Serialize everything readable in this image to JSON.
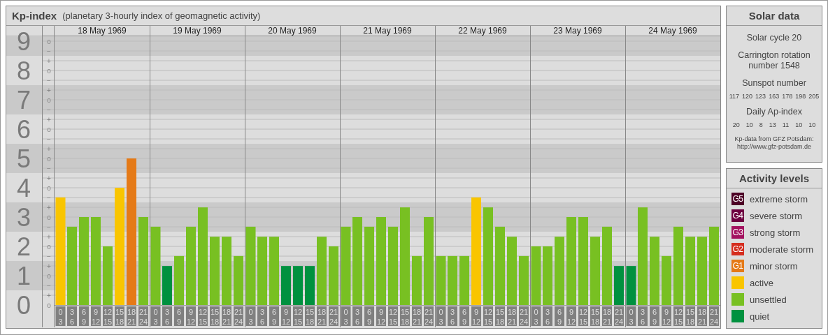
{
  "title": {
    "name": "Kp-index",
    "subtitle": "(planetary 3-hourly index of geomagnetic activity)"
  },
  "chart": {
    "dates": [
      "18 May 1969",
      "19 May 1969",
      "20 May 1969",
      "21 May 1969",
      "22 May 1969",
      "23 May 1969",
      "24 May 1969"
    ],
    "y_minor_marks": [
      "o",
      "−",
      "+",
      "o",
      "−",
      "+",
      "o",
      "−",
      "+",
      "o",
      "−",
      "+",
      "o",
      "−",
      "+",
      "o",
      "−",
      "+",
      "o",
      "−",
      "+",
      "o",
      "−",
      "+",
      "o",
      "−",
      "+",
      "o"
    ],
    "chart_data": {
      "type": "bar",
      "ylim": [
        0,
        9.2
      ],
      "yticks": [
        0,
        1,
        2,
        3,
        4,
        5,
        6,
        7,
        8,
        9
      ],
      "grid": true,
      "bands": [
        {
          "axis": "y",
          "from": 0.5,
          "to": 1.5
        },
        {
          "axis": "y",
          "from": 2.5,
          "to": 3.5
        },
        {
          "axis": "y",
          "from": 4.5,
          "to": 5.5
        },
        {
          "axis": "y",
          "from": 6.5,
          "to": 7.5
        },
        {
          "axis": "y",
          "from": 8.5,
          "to": 9.2
        }
      ],
      "categories": [
        "0\n3",
        "3\n6",
        "6\n9",
        "9\n12",
        "12\n15",
        "15\n18",
        "18\n21",
        "21\n24",
        "0\n3",
        "3\n6",
        "6\n9",
        "9\n12",
        "12\n15",
        "15\n18",
        "18\n21",
        "21\n24",
        "0\n3",
        "3\n6",
        "6\n9",
        "9\n12",
        "12\n15",
        "15\n18",
        "18\n21",
        "21\n24",
        "0\n3",
        "3\n6",
        "6\n9",
        "9\n12",
        "12\n15",
        "15\n18",
        "18\n21",
        "21\n24",
        "0\n3",
        "3\n6",
        "6\n9",
        "9\n12",
        "12\n15",
        "15\n18",
        "18\n21",
        "21\n24",
        "0\n3",
        "3\n6",
        "6\n9",
        "9\n12",
        "12\n15",
        "15\n18",
        "18\n21",
        "21\n24",
        "0\n3",
        "3\n6",
        "6\n9",
        "9\n12",
        "12\n15",
        "15\n18",
        "18\n21",
        "21\n24"
      ],
      "values": [
        3.67,
        2.67,
        3,
        3,
        2,
        4,
        5,
        3,
        2.67,
        1.33,
        1.67,
        2.67,
        3.33,
        2.33,
        2.33,
        1.67,
        2.67,
        2.33,
        2.33,
        1.33,
        1.33,
        1.33,
        2.33,
        2,
        2.67,
        3,
        2.67,
        3,
        2.67,
        3.33,
        1.67,
        3,
        1.67,
        1.67,
        1.67,
        3.67,
        3.33,
        2.67,
        2.33,
        1.67,
        2,
        2,
        2.33,
        3,
        3,
        2.33,
        2.67,
        1.33,
        1.33,
        3.33,
        2.33,
        1.67,
        2.67,
        2.33,
        2.33,
        2.67
      ]
    }
  },
  "solar": {
    "title": "Solar data",
    "cycle": "Solar cycle 20",
    "rotation": "Carrington rotation number 1548",
    "sunspot_label": "Sunspot number",
    "sunspots": [
      "117",
      "120",
      "123",
      "163",
      "178",
      "198",
      "205"
    ],
    "ap_label": "Daily Ap-index",
    "ap_values": [
      "20",
      "10",
      "8",
      "13",
      "11",
      "10",
      "10"
    ],
    "credit": [
      "Kp-data from GFZ Potsdam:",
      "http://www.gfz-potsdam.de"
    ]
  },
  "legend": {
    "title": "Activity levels",
    "items": [
      {
        "code": "G5",
        "label": "extreme storm",
        "color": "#4d0026"
      },
      {
        "code": "G4",
        "label": "severe storm",
        "color": "#6e0040"
      },
      {
        "code": "G3",
        "label": "strong storm",
        "color": "#a3125f"
      },
      {
        "code": "G2",
        "label": "moderate storm",
        "color": "#d52d1e"
      },
      {
        "code": "G1",
        "label": "minor storm",
        "color": "#e57a17"
      },
      {
        "label": "active",
        "color": "#f9c500"
      },
      {
        "label": "unsettled",
        "color": "#78c022"
      },
      {
        "label": "quiet",
        "color": "#00913f"
      }
    ]
  }
}
